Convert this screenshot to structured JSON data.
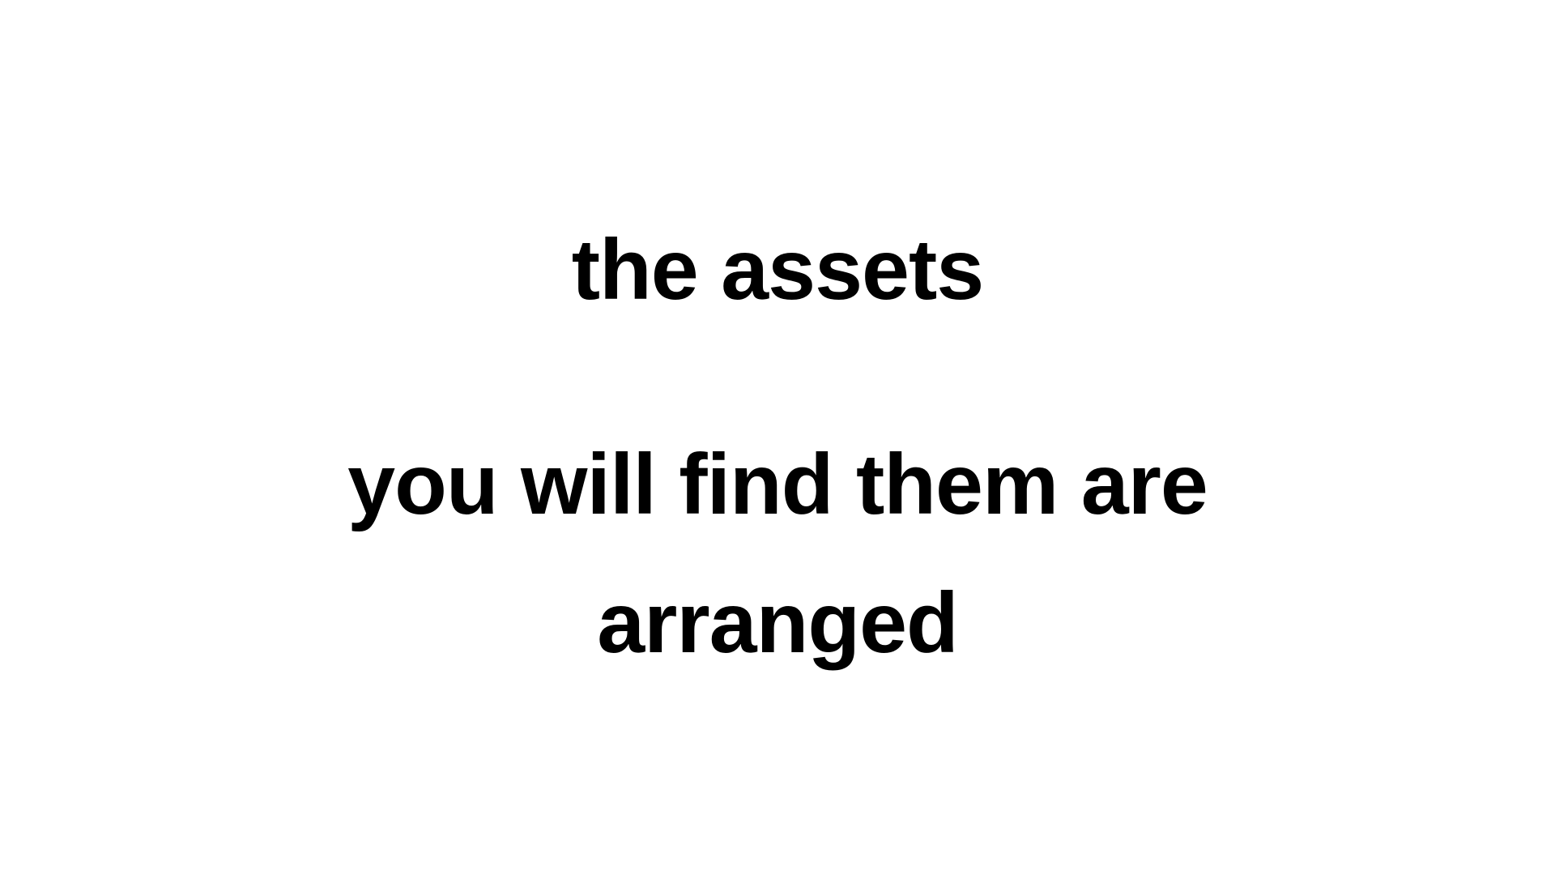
{
  "slide": {
    "lines": [
      "the assets",
      "you will find them are",
      "arranged"
    ],
    "text_color": "#000000",
    "background_color": "#ffffff"
  }
}
